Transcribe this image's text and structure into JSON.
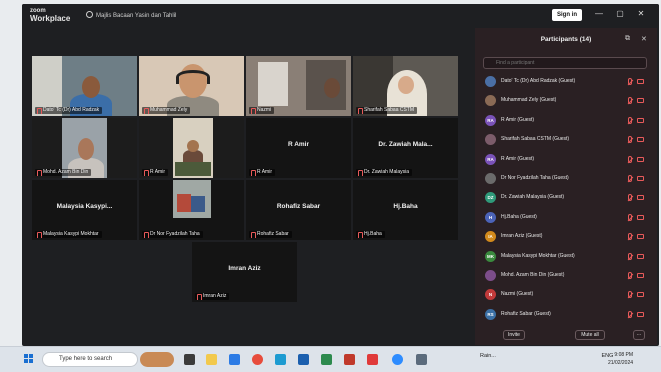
{
  "app": {
    "brand_top": "zoom",
    "brand_bottom": "Workplace",
    "meeting_title": "Majlis Bacaan Yasin dan Tahlil",
    "sign_in": "Sign in",
    "window_controls": [
      "—",
      "▢",
      "✕"
    ]
  },
  "tiles": [
    {
      "name": "Dato' Tc (Dr) Abd Radzak",
      "big": "",
      "video": true,
      "active": true,
      "scene": "a"
    },
    {
      "name": "Muhammad Zely",
      "big": "",
      "video": true,
      "active": false,
      "scene": "b"
    },
    {
      "name": "Nazmi",
      "big": "",
      "video": true,
      "active": false,
      "scene": "c"
    },
    {
      "name": "Sharifah Sabaa CSTM",
      "big": "",
      "video": true,
      "active": false,
      "scene": "d"
    },
    {
      "name": "Mohd. Azam Bin Din",
      "big": "",
      "video": true,
      "active": false,
      "scene": "e"
    },
    {
      "name": "R Amir",
      "big": "",
      "video": true,
      "active": false,
      "scene": "f"
    },
    {
      "name": "R Amir",
      "big": "R Amir",
      "video": false,
      "active": false,
      "scene": ""
    },
    {
      "name": "Dr. Zawiah Malaysia",
      "big": "Dr. Zawiah Mala...",
      "video": false,
      "active": false,
      "scene": ""
    },
    {
      "name": "Malaysia Kasypi Mokhtar",
      "big": "Malaysia Kasypi...",
      "video": false,
      "active": false,
      "scene": ""
    },
    {
      "name": "Dr Nor Fyadzilah Taha",
      "big": "",
      "video": true,
      "active": false,
      "scene": "g"
    },
    {
      "name": "Rohafiz Sabar",
      "big": "Rohafiz Sabar",
      "video": false,
      "active": false,
      "scene": ""
    },
    {
      "name": "Hj.Baha",
      "big": "Hj.Baha",
      "video": false,
      "active": false,
      "scene": ""
    },
    {
      "name": "Imran Aziz",
      "big": "Imran Aziz",
      "video": false,
      "active": false,
      "scene": ""
    }
  ],
  "participants": {
    "title": "Participants (14)",
    "search_placeholder": "Find a participant",
    "list": [
      {
        "initials": "",
        "name": "Dato' Tc (Dr) Abd Radzak (Guest)",
        "color": "#4a6fa5"
      },
      {
        "initials": "",
        "name": "Muhammad Zely (Guest)",
        "color": "#8a6a55"
      },
      {
        "initials": "RA",
        "name": "R Amir (Guest)",
        "color": "#7a52b8"
      },
      {
        "initials": "",
        "name": "Sharifah Sabaa CSTM (Guest)",
        "color": "#7c5c6a"
      },
      {
        "initials": "RA",
        "name": "R Amir (Guest)",
        "color": "#7a52b8"
      },
      {
        "initials": "",
        "name": "Dr Nor Fyadzilah Taha (Guest)",
        "color": "#6b6b6b"
      },
      {
        "initials": "DZ",
        "name": "Dr. Zawiah Malaysia (Guest)",
        "color": "#2f9a7a"
      },
      {
        "initials": "H",
        "name": "Hj.Baha (Guest)",
        "color": "#4b63b8"
      },
      {
        "initials": "IA",
        "name": "Imran Aziz (Guest)",
        "color": "#d28a1c"
      },
      {
        "initials": "MK",
        "name": "Malaysia Kasypi Mokhtar (Guest)",
        "color": "#3a8a3e"
      },
      {
        "initials": "",
        "name": "Mohd. Azam Bin Din (Guest)",
        "color": "#7c4d8a"
      },
      {
        "initials": "N",
        "name": "Nazmi (Guest)",
        "color": "#c23a3a"
      },
      {
        "initials": "RS",
        "name": "Rohafiz Sabar (Guest)",
        "color": "#3a6fa5"
      }
    ],
    "invite": "Invite",
    "mute_all": "Mute all",
    "more": "···"
  },
  "taskbar": {
    "search_placeholder": "Type here to search",
    "weather": "Rain...",
    "lang": "ENG",
    "time": "9:08 PM",
    "date": "21/02/2024"
  }
}
